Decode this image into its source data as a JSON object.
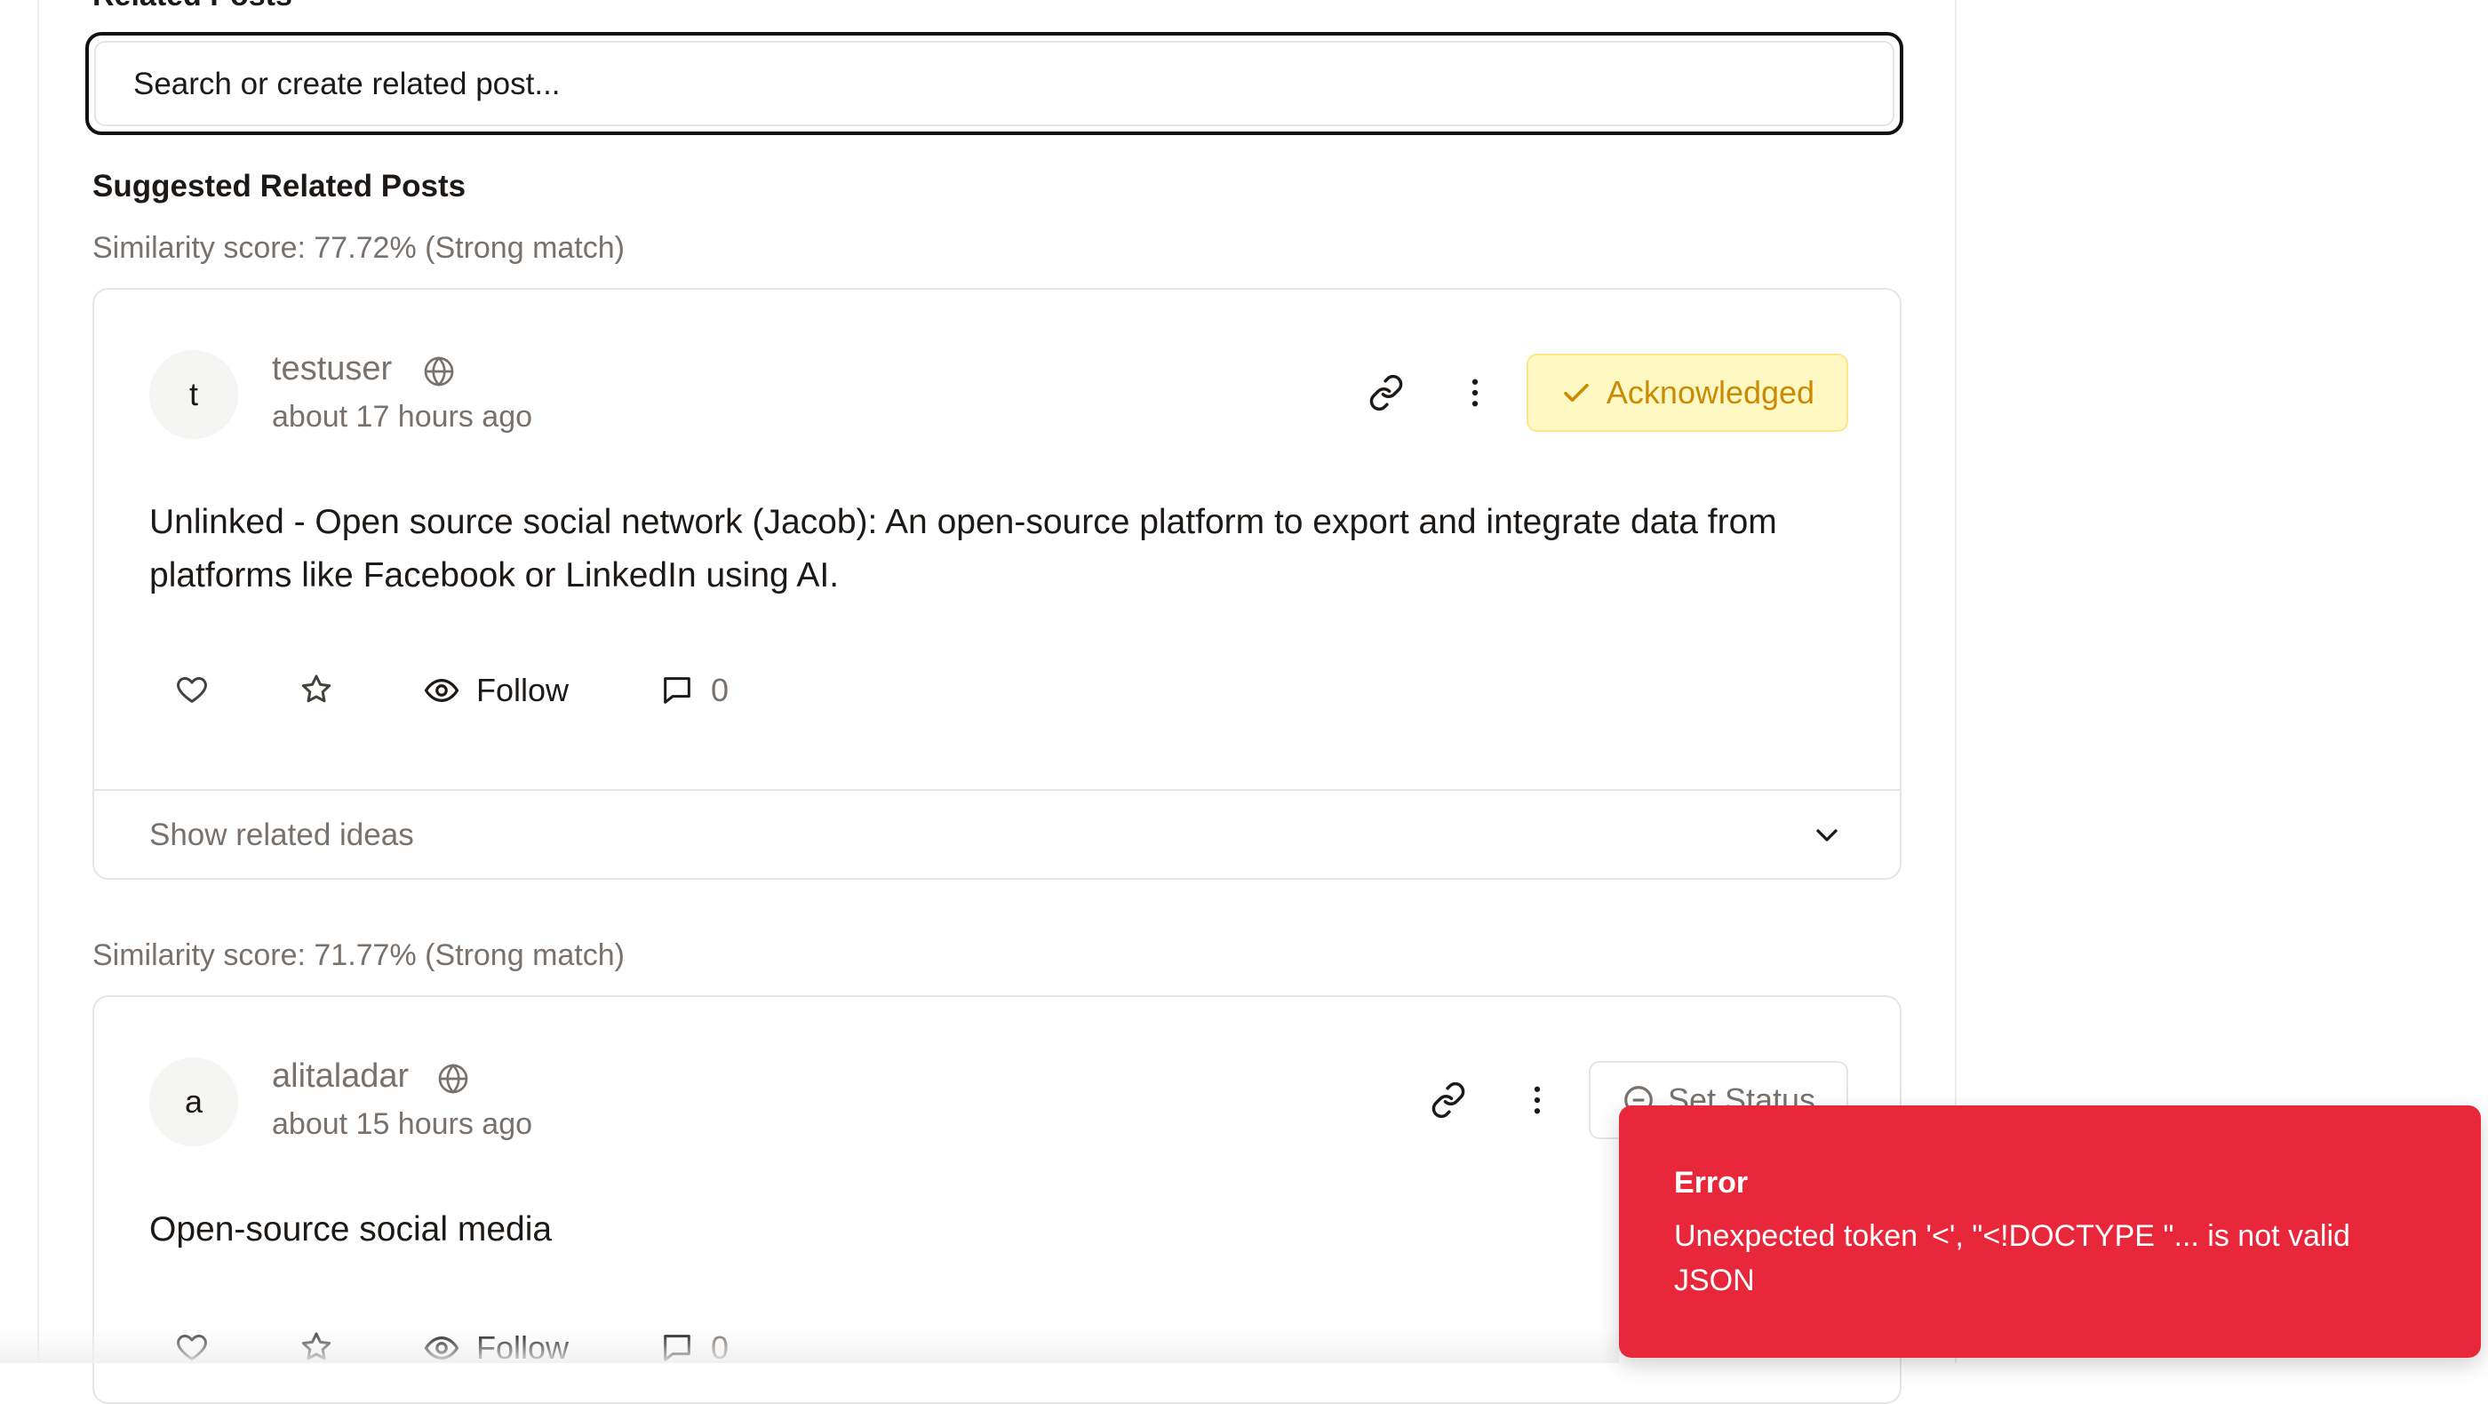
{
  "section": {
    "title": "Related Posts"
  },
  "search": {
    "placeholder": "Search or create related post..."
  },
  "suggested": {
    "title": "Suggested Related Posts"
  },
  "posts": [
    {
      "similarity": "Similarity score: 77.72% (Strong match)",
      "avatar_letter": "t",
      "username": "testuser",
      "timestamp": "about 17 hours ago",
      "status_label": "Acknowledged",
      "status_color": "#ca8a04",
      "body": "Unlinked - Open source social network (Jacob): An open-source platform to export and integrate data from platforms like Facebook or LinkedIn using AI.",
      "follow_label": "Follow",
      "comment_count": "0",
      "related_toggle": "Show related ideas"
    },
    {
      "similarity": "Similarity score: 71.77% (Strong match)",
      "avatar_letter": "a",
      "username": "alitaladar",
      "timestamp": "about 15 hours ago",
      "status_label": "Set Status",
      "body": "Open-source social media",
      "follow_label": "Follow",
      "comment_count": "0"
    }
  ],
  "toast": {
    "title": "Error",
    "message": "Unexpected token '<', \"<!DOCTYPE \"... is not valid JSON",
    "background": "#e8283a"
  }
}
